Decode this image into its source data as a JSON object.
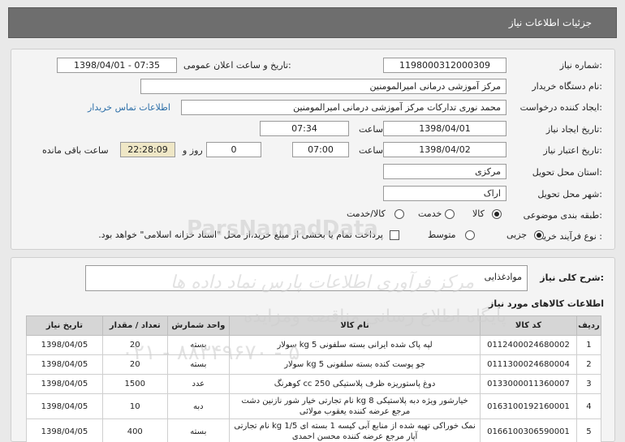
{
  "header": {
    "title": "جزئیات اطلاعات نیاز"
  },
  "form": {
    "need_number_label": "شماره نیاز:",
    "need_number": "1198000312000309",
    "announce_label": "تاریخ و ساعت اعلان عمومی:",
    "announce_value": "1398/04/01 - 07:35",
    "buyer_label": "نام دستگاه خریدار:",
    "buyer_value": "مرکز آموزشی درمانی امیرالمومنین",
    "creator_label": "ایجاد کننده درخواست:",
    "creator_value": "محمد نوری تدارکات مرکز آموزشی درمانی امیرالمومنین",
    "contact_link": "اطلاعات تماس خریدار",
    "created_date_label": "تاریخ ایجاد نیاز:",
    "created_date": "1398/04/01",
    "time_label": "ساعت",
    "created_time": "07:34",
    "validity_label": "تاریخ اعتبار نیاز:",
    "validity_date": "1398/04/02",
    "validity_time": "07:00",
    "days_value": "0",
    "days_label": "روز و",
    "remaining_value": "22:28:09",
    "remaining_label": "ساعت باقی مانده",
    "province_label": "استان محل تحویل:",
    "province_value": "مرکزی",
    "city_label": "شهر محل تحویل:",
    "city_value": "اراک",
    "category_label": "طبقه بندی موضوعی:",
    "category_options": [
      "کالا",
      "خدمت",
      "کالا/خدمت"
    ],
    "process_label": "نوع فرآیند خرید :",
    "process_options": [
      "جزیی",
      "متوسط"
    ],
    "payment_note": "پرداخت تمام یا بخشی از مبلغ خرید،از محل \"اسناد خزانه اسلامی\" خواهد بود."
  },
  "summary": {
    "label": "شرح کلی نیاز:",
    "value": "موادغذایی",
    "items_title": "اطلاعات کالاهای مورد نیاز"
  },
  "table": {
    "headers": [
      "ردیف",
      "کد کالا",
      "نام کالا",
      "واحد شمارش",
      "تعداد / مقدار",
      "تاریخ نیاز"
    ],
    "rows": [
      {
        "n": "1",
        "code": "0112400024680002",
        "name": "لپه پاک شده ایرانی بسته سلفونی 5 kg سولار",
        "unit": "بسته",
        "qty": "20",
        "date": "1398/04/05"
      },
      {
        "n": "2",
        "code": "0111300024680004",
        "name": "جو پوست کنده بسته سلفونی 5 kg سولار",
        "unit": "بسته",
        "qty": "20",
        "date": "1398/04/05"
      },
      {
        "n": "3",
        "code": "0133000011360007",
        "name": "دوغ پاستوریزه ظرف پلاستیکی 250 cc کوهرنگ",
        "unit": "عدد",
        "qty": "1500",
        "date": "1398/04/05"
      },
      {
        "n": "4",
        "code": "0163100192160001",
        "name": "خیارشور ویژه دبه پلاستیکی 8 kg نام تجارتی خیار شور نازنین دشت مرجع عرضه کننده یعقوب مولائی",
        "unit": "دبه",
        "qty": "10",
        "date": "1398/04/05"
      },
      {
        "n": "5",
        "code": "0166100306590001",
        "name": "نمک خوراکی تهیه شده از منابع آبی کیسه 1 بسته ای 1/5 kg نام تجارتی آپار مرجع عرضه کننده محسن احمدی",
        "unit": "بسته",
        "qty": "400",
        "date": "1398/04/05"
      }
    ]
  },
  "watermark": {
    "line1": "مرکز فرآوری اطلاعات پارس نماد داده ها",
    "line2": "پایگاه اطلاع رسانی مناقصه ومزایده",
    "line3": "ParsNamadData",
    "line4": "۰۲۱ - ۸۸۳۴۹۶۷۰ - ۵"
  }
}
